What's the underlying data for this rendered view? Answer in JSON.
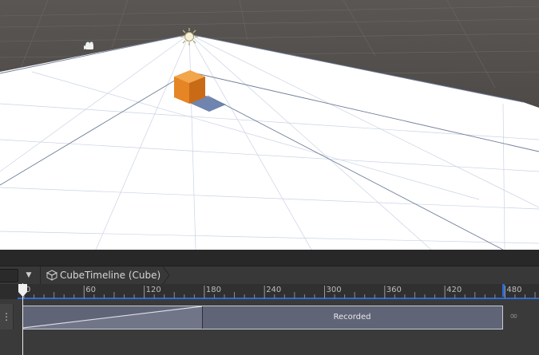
{
  "timeline": {
    "name": "CubeTimeline (Cube)",
    "frame_ticks": [
      "0",
      "60",
      "120",
      "180",
      "240",
      "300",
      "360",
      "420",
      "480"
    ]
  },
  "track": {
    "clip_label": "Recorded"
  },
  "colors": {
    "sky": "#4a4643",
    "ground_plane": "#ffffff",
    "cube": "#e8862a",
    "clip": "#5f6477",
    "end_marker": "#2e6ad1",
    "panel": "#3c3c3c"
  },
  "icons": [
    "camera-gizmo-icon",
    "sun-gizmo-icon",
    "cube-icon",
    "dropdown-arrow-icon",
    "track-menu-icon",
    "infinity-icon"
  ]
}
